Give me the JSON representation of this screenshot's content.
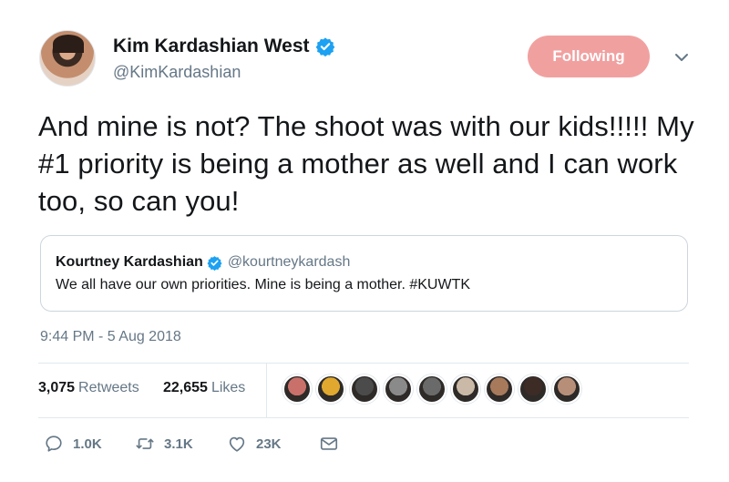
{
  "author": {
    "name": "Kim Kardashian West",
    "handle": "@KimKardashian",
    "verified": true
  },
  "follow_button": {
    "label": "Following",
    "color": "#f1a0a0"
  },
  "tweet": {
    "text": "And mine is not? The shoot was with our kids!!!!! My #1 priority is being a mother as well and I can work too, so can you!",
    "timestamp": "9:44 PM - 5 Aug 2018"
  },
  "quoted_tweet": {
    "name": "Kourtney Kardashian",
    "handle": "@kourtneykardash",
    "verified": true,
    "text": "We all have our own priorities. Mine is being a mother. #KUWTK"
  },
  "stats": {
    "retweets_count": "3,075",
    "retweets_label": "Retweets",
    "likes_count": "22,655",
    "likes_label": "Likes"
  },
  "liker_avatars": [
    "#c9706a",
    "#e0a82e",
    "#4b4b4b",
    "#8a8a8a",
    "#6a6a6a",
    "#c9b9a6",
    "#a77a5c",
    "#3d2b26",
    "#b78f79"
  ],
  "actions": {
    "reply_count": "1.0K",
    "retweet_count": "3.1K",
    "like_count": "23K"
  },
  "icons": {
    "verified": "verified-badge-icon",
    "caret": "chevron-down-icon",
    "reply": "reply-icon",
    "retweet": "retweet-icon",
    "like": "heart-icon",
    "dm": "envelope-icon"
  },
  "colors": {
    "verified": "#1da1f2",
    "secondary_text": "#657786",
    "primary_text": "#14171a"
  }
}
